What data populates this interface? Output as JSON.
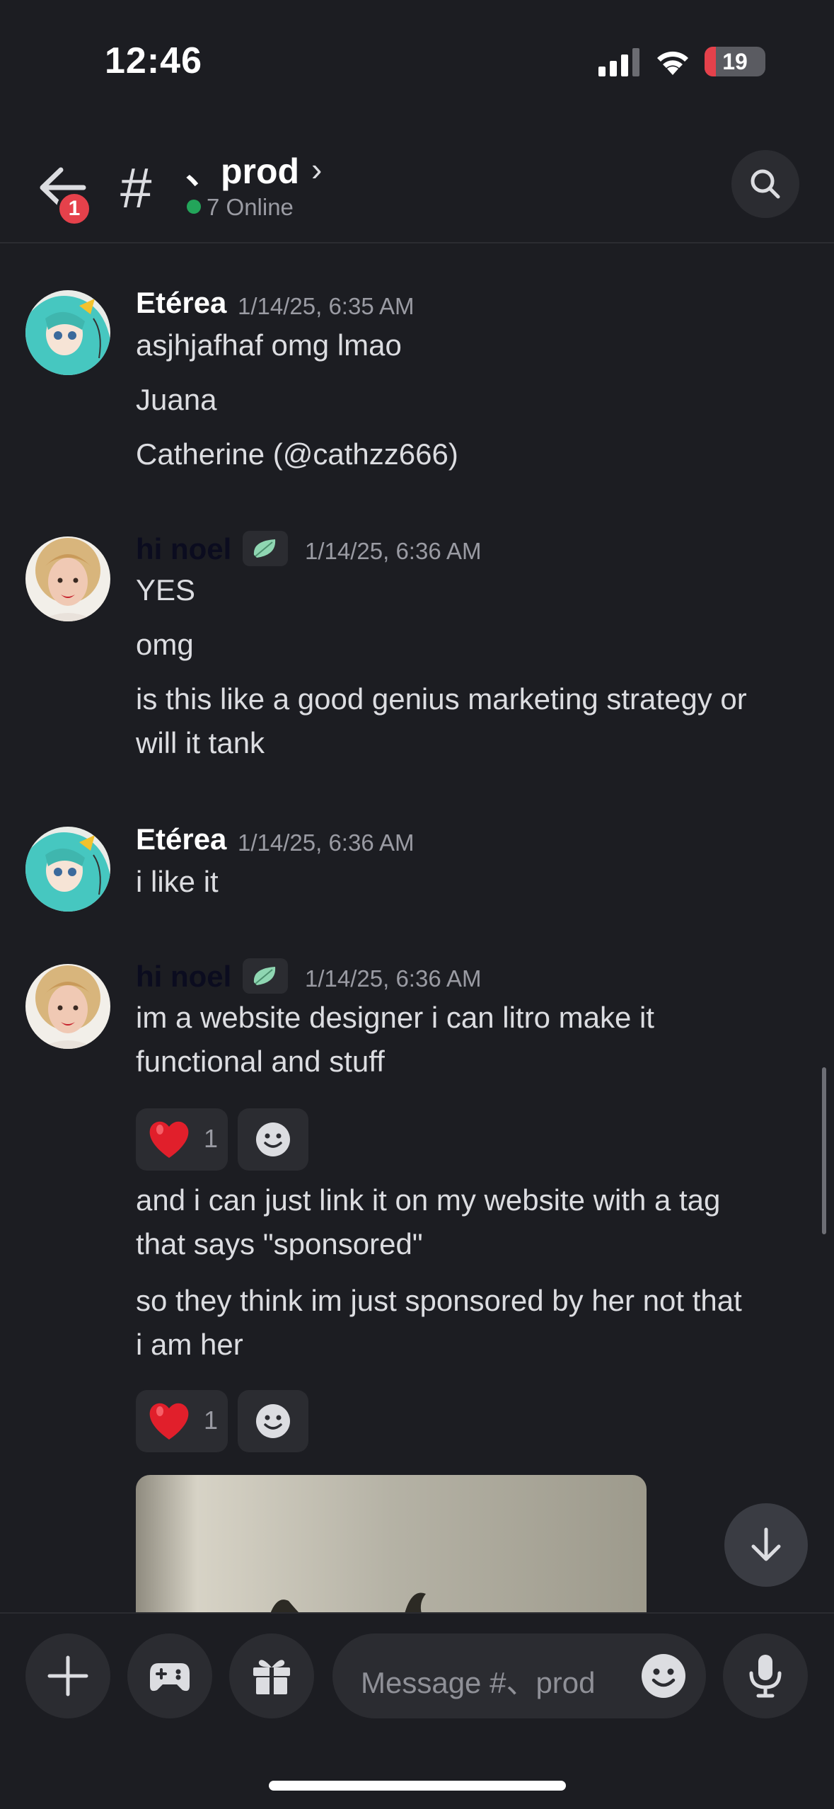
{
  "status_bar": {
    "time": "12:46",
    "battery": "19",
    "battery_level": 0.19
  },
  "header": {
    "channel_name": "、prod",
    "online": "7 Online",
    "back_badge": "1"
  },
  "messages": [
    {
      "author": "Etérea",
      "timestamp": "1/14/25, 6:35 AM",
      "lines": [
        "asjhjafhaf omg lmao",
        "Juana",
        "Catherine (@cathzz666)"
      ]
    },
    {
      "author": "hi noel",
      "timestamp": "1/14/25, 6:36 AM",
      "lines": [
        "YES",
        "omg",
        "is this like a good genius marketing strategy or",
        "will it tank"
      ]
    },
    {
      "author": "Etérea",
      "timestamp": "1/14/25, 6:36 AM",
      "lines": [
        "i like it"
      ]
    },
    {
      "author": "hi noel",
      "timestamp": "1/14/25, 6:36 AM",
      "lines": [
        "im a website designer i can litro make it",
        "functional and stuff",
        "and i can just link it on my website with a tag",
        "that says \"sponsored\"",
        "so they think im just sponsored by her not that",
        "i am her"
      ],
      "reactions": [
        {
          "emoji": "heart",
          "count": "1"
        },
        {
          "emoji": "heart",
          "count": "1"
        }
      ]
    }
  ],
  "composer": {
    "placeholder": "Message #、prod"
  },
  "colors": {
    "accent_red": "#e5414b",
    "online_green": "#23a55a",
    "background": "#1c1d22"
  }
}
